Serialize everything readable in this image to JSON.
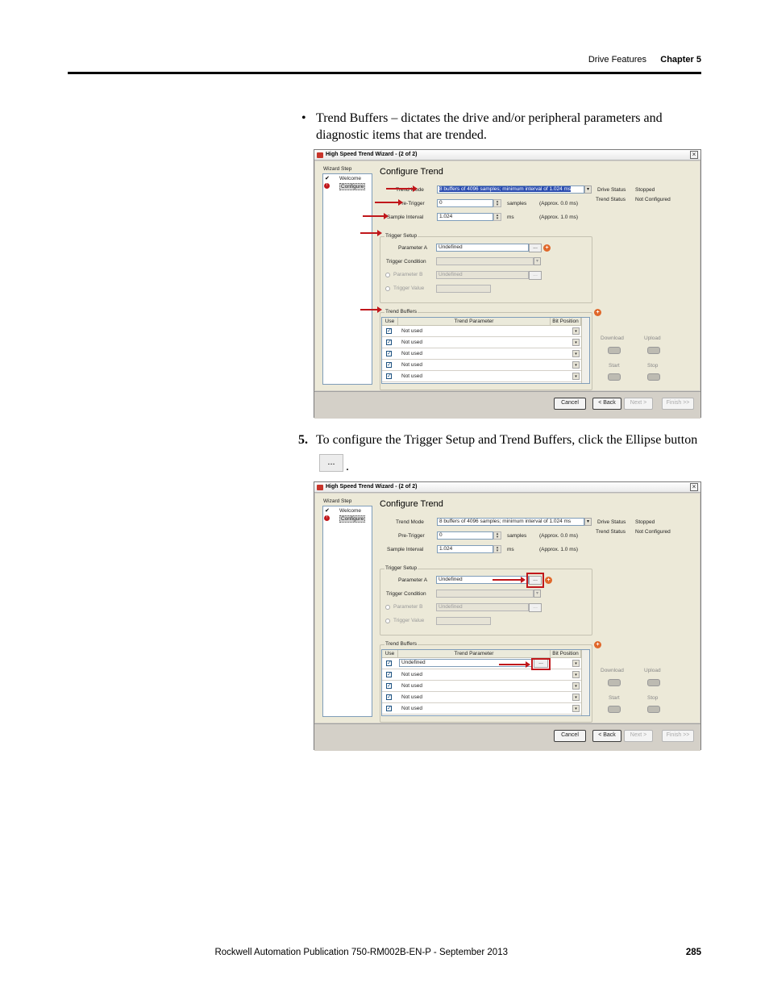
{
  "header": {
    "section": "Drive Features",
    "chapter": "Chapter 5"
  },
  "bullet_text": "Trend Buffers – dictates the drive and/or peripheral parameters and diagnostic items that are trended.",
  "bullet_line1": "Trend Buffers – dictates the drive and/or peripheral parameters and",
  "bullet_line2": "diagnostic items that are trended.",
  "step": {
    "number": "5.",
    "text": "To configure the Trigger Setup and Trend Buffers, click the Ellipse button",
    "button_label": "...",
    "end": "."
  },
  "dialog": {
    "title": "High Speed Trend Wizard - (2 of 2)",
    "close": "×",
    "wizard_step_label": "Wizard Step",
    "steps": [
      "Welcome",
      "Configure"
    ],
    "heading": "Configure Trend",
    "trend_mode_label": "Trend Mode",
    "trend_mode_value": "8 buffers of 4096 samples; minimum interval of 1.024 ms",
    "pre_trigger_label": "Pre-Trigger",
    "pre_trigger_value": "0",
    "pre_trigger_unit": "samples",
    "pre_trigger_approx": "(Approx. 0.0 ms)",
    "sample_interval_label": "Sample Interval",
    "sample_interval_value": "1.024",
    "sample_interval_unit": "ms",
    "sample_interval_approx": "(Approx. 1.0 ms)",
    "drive_status_label": "Drive Status",
    "drive_status_value": "Stopped",
    "trend_status_label": "Trend Status",
    "trend_status_value": "Not Configured",
    "trigger_setup_label": "Trigger Setup",
    "parameter_a_label": "Parameter A",
    "parameter_a_value": "Undefined",
    "trigger_condition_label": "Trigger Condition",
    "parameter_b_label": "Parameter B",
    "parameter_b_value": "Undefined",
    "trigger_value_label": "Trigger Value",
    "trend_buffers_label": "Trend Buffers",
    "grid_headers": [
      "Use",
      "Trend Parameter",
      "Bit Position"
    ],
    "rows_1": [
      "Not used",
      "Not used",
      "Not used",
      "Not used",
      "Not used"
    ],
    "rows_2": [
      "Undefined",
      "Not used",
      "Not used",
      "Not used",
      "Not used"
    ],
    "download_label": "Download",
    "upload_label": "Upload",
    "start_label": "Start",
    "stop_label": "Stop",
    "cancel_label": "Cancel",
    "back_label": "< Back",
    "next_label": "Next >",
    "finish_label": "Finish >>",
    "ellipsis": "...",
    "plus": "+"
  },
  "footer": {
    "publication": "Rockwell Automation Publication 750-RM002B-EN-P - September 2013",
    "page": "285"
  },
  "colors": {
    "annotation": "#c0171b",
    "dialog_bg": "#ece9d8"
  }
}
